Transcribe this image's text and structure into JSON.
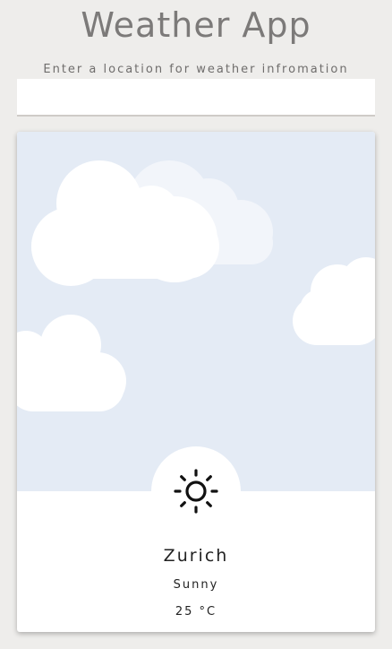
{
  "header": {
    "title": "Weather App",
    "prompt": "Enter a location for weather infromation"
  },
  "search": {
    "value": "",
    "placeholder": ""
  },
  "weather": {
    "city": "Zurich",
    "condition": "Sunny",
    "temperature": "25 °C",
    "icon": "sun-icon"
  },
  "colors": {
    "background": "#eeedeb",
    "sky": "#e4ebf5",
    "card": "#ffffff",
    "title": "#7c7a79"
  }
}
